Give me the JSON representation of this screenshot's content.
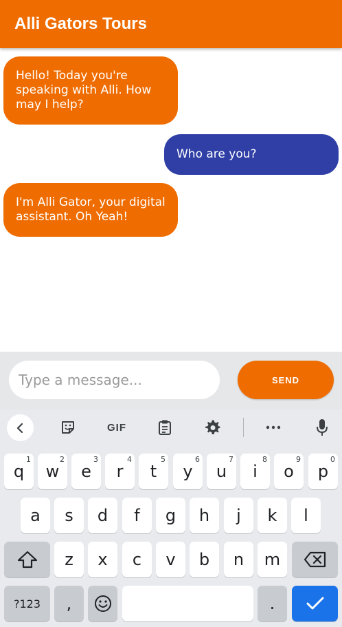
{
  "header": {
    "title": "Alli Gators Tours"
  },
  "colors": {
    "brand": "#ef6c00",
    "user_bubble": "#2f3fa5",
    "keyboard_bg": "#e8eaed",
    "enter_key": "#1a73e8"
  },
  "messages": [
    {
      "sender": "bot",
      "text": "Hello! Today you're speaking with Alli. How may I help?"
    },
    {
      "sender": "user",
      "text": "Who are you?"
    },
    {
      "sender": "bot",
      "text": "I'm Alli Gator, your digital assistant. Oh Yeah!"
    }
  ],
  "composer": {
    "placeholder": "Type a message...",
    "value": "",
    "send_label": "SEND"
  },
  "keyboard": {
    "toolbar": {
      "gif_label": "GIF",
      "icons": [
        "back-icon",
        "sticker-icon",
        "gif-icon",
        "clipboard-icon",
        "gear-icon",
        "more-icon",
        "microphone-icon"
      ]
    },
    "row1": [
      {
        "key": "q",
        "hint": "1"
      },
      {
        "key": "w",
        "hint": "2"
      },
      {
        "key": "e",
        "hint": "3"
      },
      {
        "key": "r",
        "hint": "4"
      },
      {
        "key": "t",
        "hint": "5"
      },
      {
        "key": "y",
        "hint": "6"
      },
      {
        "key": "u",
        "hint": "7"
      },
      {
        "key": "i",
        "hint": "8"
      },
      {
        "key": "o",
        "hint": "9"
      },
      {
        "key": "p",
        "hint": "0"
      }
    ],
    "row2": [
      "a",
      "s",
      "d",
      "f",
      "g",
      "h",
      "j",
      "k",
      "l"
    ],
    "row3": [
      "z",
      "x",
      "c",
      "v",
      "b",
      "n",
      "m"
    ],
    "row4": {
      "symbols_label": "?123",
      "comma": ",",
      "period": "."
    }
  }
}
